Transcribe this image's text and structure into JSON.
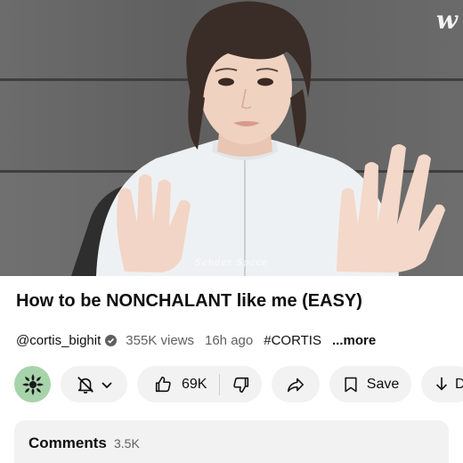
{
  "video": {
    "watermark": "w",
    "overlay_logo": "Sender Space"
  },
  "title": "How to be NONCHALANT like me (EASY)",
  "meta": {
    "channel_handle": "@cortis_bighit",
    "views": "355K views",
    "time_ago": "16h ago",
    "hashtag": "#CORTIS",
    "more_label": "...more"
  },
  "actions": {
    "likes": "69K",
    "save_label": "Save",
    "download_label": "D"
  },
  "comments": {
    "label": "Comments",
    "count": "3.5K"
  },
  "icons": {
    "verified": "verified-check-icon",
    "bell": "bell-icon",
    "like": "thumbs-up-icon",
    "dislike": "thumbs-down-icon",
    "share": "share-arrow-icon",
    "save": "bookmark-icon",
    "download": "download-arrow-icon"
  },
  "colors": {
    "avatar_bg": "#a7d3aa",
    "pill_bg": "#f2f2f2",
    "secondary_text": "#606060"
  }
}
